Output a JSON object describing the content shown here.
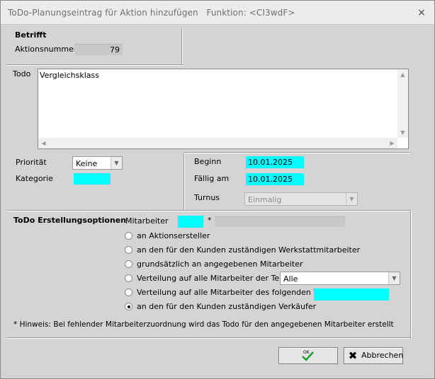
{
  "window": {
    "title": "ToDo-Planungseintrag für Aktion hinzufügen",
    "function_label": "Funktion: <CI3wdF>",
    "close_icon": "×"
  },
  "betrifft": {
    "heading": "Betrifft",
    "aktionsnummer_label": "Aktionsnummer",
    "aktionsnummer_value": "79"
  },
  "todo": {
    "label": "Todo",
    "text": "Vergleichsklass"
  },
  "prioritaet": {
    "label": "Priorität",
    "value": "Keine"
  },
  "kategorie": {
    "label": "Kategorie",
    "value": ""
  },
  "beginn": {
    "label": "Beginn",
    "value": "10.01.2025"
  },
  "faellig": {
    "label": "Fällig am",
    "value": "10.01.2025"
  },
  "turnus": {
    "label": "Turnus",
    "value": "Einmalig"
  },
  "options": {
    "heading": "ToDo Erstellungsoptionen",
    "mitarbeiter_label": "Mitarbeiter",
    "mitarbeiter_value": "",
    "asterisk": "*",
    "mitarbeiter_name": "",
    "radios": [
      {
        "label": "an Aktionsersteller",
        "checked": false
      },
      {
        "label": "an den für den Kunden zuständigen Werkstattmitarbeiter",
        "checked": false
      },
      {
        "label": "grundsätzlich an angegebenen Mitarbeiter",
        "checked": false
      },
      {
        "label": "Verteilung auf alle Mitarbeiter der Teamart",
        "checked": false
      },
      {
        "label": "Verteilung auf alle Mitarbeiter des folgenden Teams",
        "checked": false
      },
      {
        "label": "an den für den Kunden zuständigen Verkäufer",
        "checked": true
      }
    ],
    "teamart_value": "Alle",
    "team_value": "",
    "hint": "* Hinweis: Bei fehlender Mitarbeiterzuordnung wird das Todo für den angegebenen Mitarbeiter erstellt"
  },
  "buttons": {
    "ok_label": "OK",
    "cancel_label": "Abbrechen"
  },
  "colors": {
    "required_field": "#00ffff",
    "ok_check": "#1e9e2a"
  }
}
